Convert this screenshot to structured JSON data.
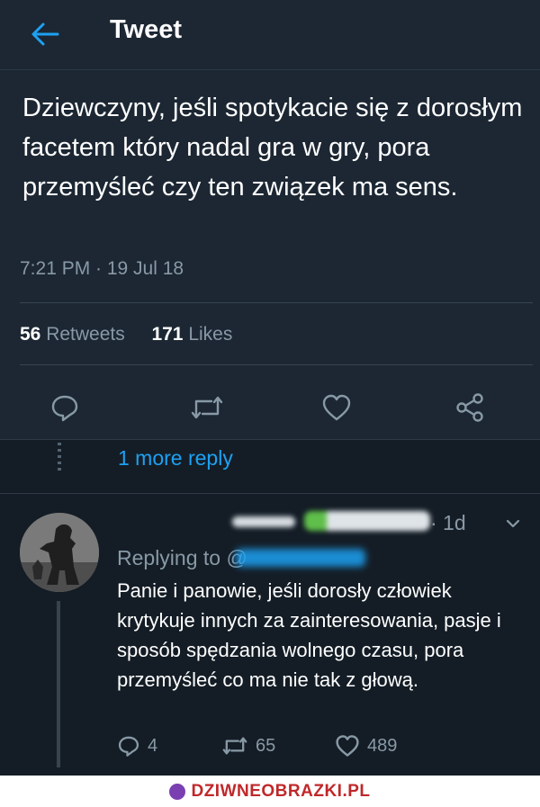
{
  "header": {
    "title": "Tweet",
    "back_icon": "arrow-left-icon"
  },
  "tweet": {
    "text": "Dziewczyny, jeśli spotykacie się z dorosłym facetem który nadal gra w gry, pora przemyśleć czy ten związek ma sens.",
    "timestamp": "7:21 PM · 19 Jul 18",
    "retweets_count": "56",
    "retweets_label": "Retweets",
    "likes_count": "171",
    "likes_label": "Likes"
  },
  "actions": [
    {
      "icon": "reply-icon"
    },
    {
      "icon": "retweet-icon"
    },
    {
      "icon": "heart-icon"
    },
    {
      "icon": "share-icon"
    }
  ],
  "more_reply": "1 more reply",
  "reply": {
    "time": "· 1d",
    "replying_to": "Replying to @",
    "text": "Panie i panowie, jeśli dorosły człowiek krytykuje innych za zainteresowania, pasje i sposób spędzania wolnego czasu, pora przemyśleć co ma nie tak z głową.",
    "reply_count": "4",
    "retweet_count": "65",
    "like_count": "489"
  },
  "footer": {
    "brand": "DZIWNEOBRAZKI.PL"
  },
  "colors": {
    "accent": "#1da1f2",
    "background": "#141d26",
    "muted": "#8899a6"
  }
}
